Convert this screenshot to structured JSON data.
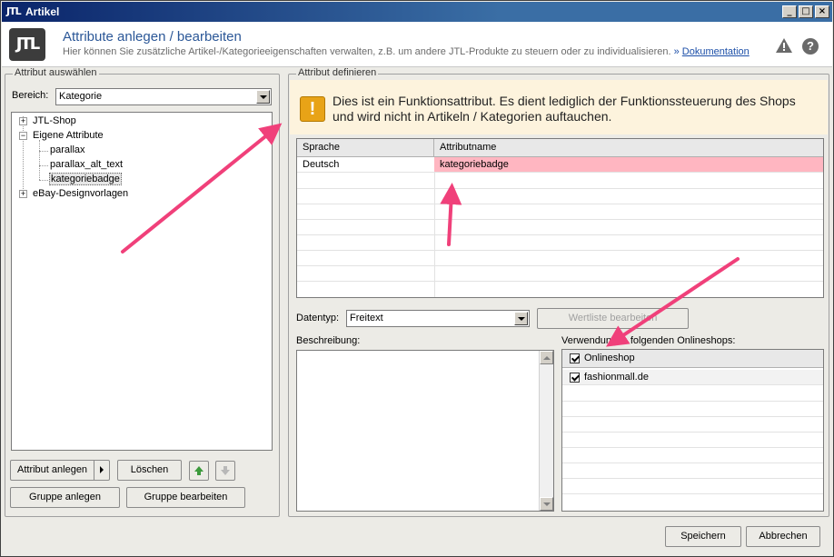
{
  "window": {
    "logo": "JTL",
    "title": "Artikel",
    "minimize": "_",
    "maximize": "□",
    "close": "×"
  },
  "header": {
    "logo": "JTL",
    "title": "Attribute anlegen / bearbeiten",
    "subtitle": "Hier können Sie zusätzliche Artikel-/Kategorieeigenschaften verwalten, z.B. um andere JTL-Produkte zu steuern oder zu individualisieren.",
    "link_prefix": "»",
    "link": "Dokumentation",
    "help": "?"
  },
  "left_panel": {
    "group_label": "Attribut auswählen",
    "bereich_label": "Bereich:",
    "bereich_value": "Kategorie",
    "tree": [
      {
        "label": "JTL-Shop",
        "expander": "+"
      },
      {
        "label": "Eigene Attribute",
        "expander": "−"
      },
      {
        "label": "parallax"
      },
      {
        "label": "parallax_alt_text"
      },
      {
        "label": "kategoriebadge",
        "selected": true
      },
      {
        "label": "eBay-Designvorlagen",
        "expander": "+"
      }
    ],
    "btn_attribut_anlegen": "Attribut anlegen",
    "btn_loeschen": "Löschen",
    "btn_gruppe_anlegen": "Gruppe anlegen",
    "btn_gruppe_bearbeiten": "Gruppe bearbeiten"
  },
  "right_panel": {
    "group_label": "Attribut definieren",
    "info_icon": "!",
    "info_text": "Dies ist ein Funktionsattribut. Es dient lediglich der Funktionssteuerung des Shops und wird nicht in Artikeln / Kategorien auftauchen.",
    "grid": {
      "col_sprache": "Sprache",
      "col_attributname": "Attributname",
      "rows": [
        {
          "sprache": "Deutsch",
          "attributname": "kategoriebadge"
        }
      ]
    },
    "datentyp_label": "Datentyp:",
    "datentyp_value": "Freitext",
    "btn_wertliste": "Wertliste bearbeiten",
    "beschreibung_label": "Beschreibung:",
    "shops_label": "Verwendung in folgenden Onlineshops:",
    "shops_header": "Onlineshop",
    "shops": [
      {
        "name": "fashionmall.de",
        "checked": true
      }
    ]
  },
  "footer": {
    "btn_speichern": "Speichern",
    "btn_abbrechen": "Abbrechen"
  },
  "colors": {
    "highlight_row": "#ffb6c1",
    "arrow": "#f0407a",
    "info_bg": "#fdf3dd"
  }
}
